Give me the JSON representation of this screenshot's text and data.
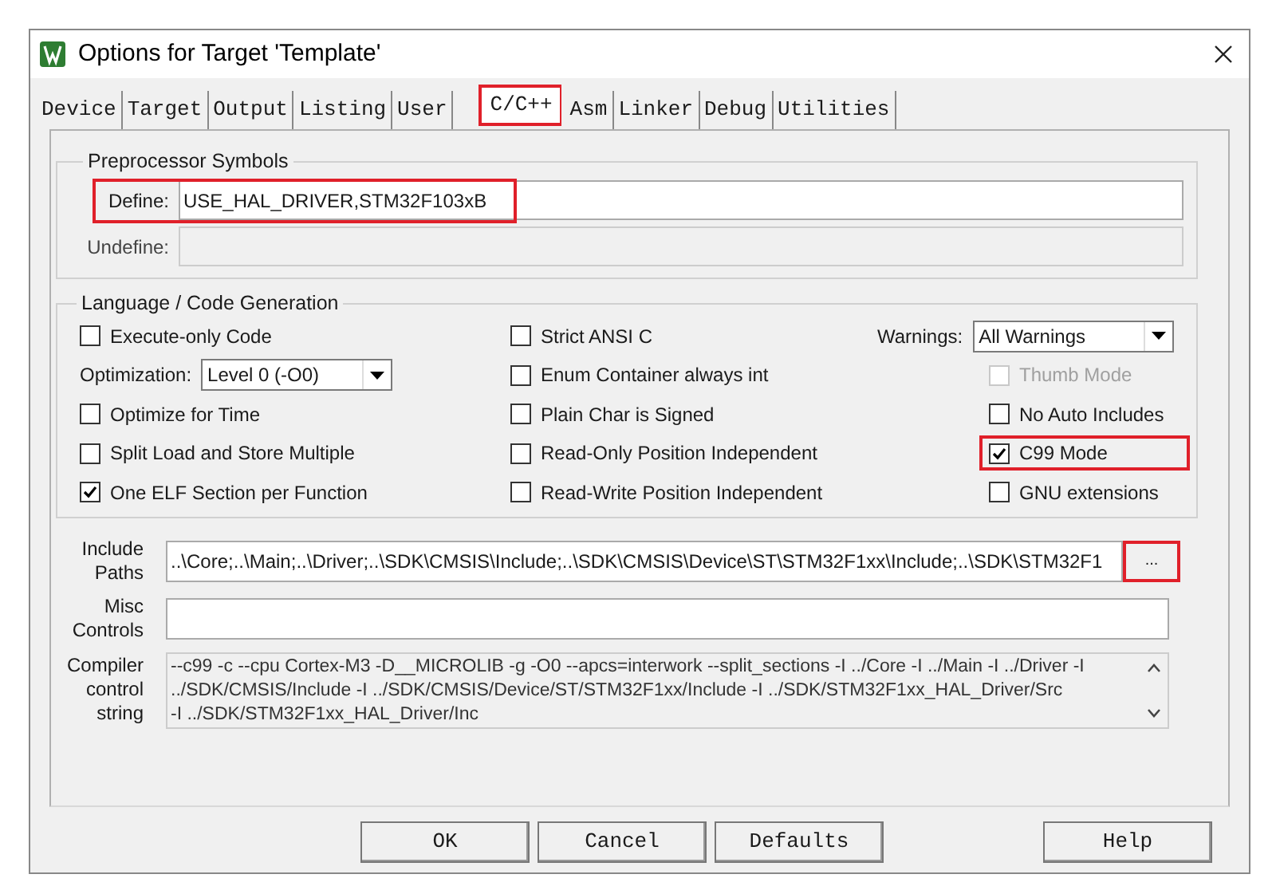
{
  "window": {
    "title": "Options for Target 'Template'"
  },
  "tabs": [
    {
      "label": "Device",
      "selected": false,
      "highlighted": false
    },
    {
      "label": "Target",
      "selected": false,
      "highlighted": false
    },
    {
      "label": "Output",
      "selected": false,
      "highlighted": false
    },
    {
      "label": "Listing",
      "selected": false,
      "highlighted": false
    },
    {
      "label": "User",
      "selected": false,
      "highlighted": false
    },
    {
      "label": "C/C++",
      "selected": true,
      "highlighted": true
    },
    {
      "label": "Asm",
      "selected": false,
      "highlighted": false
    },
    {
      "label": "Linker",
      "selected": false,
      "highlighted": false
    },
    {
      "label": "Debug",
      "selected": false,
      "highlighted": false
    },
    {
      "label": "Utilities",
      "selected": false,
      "highlighted": false
    }
  ],
  "preprocessor": {
    "title": "Preprocessor Symbols",
    "define": {
      "label": "Define:",
      "value": "USE_HAL_DRIVER,STM32F103xB",
      "highlighted": true
    },
    "undefine": {
      "label": "Undefine:",
      "disabled": true
    }
  },
  "language": {
    "title": "Language / Code Generation",
    "columns": [
      [
        {
          "kind": "checkbox",
          "label": "Execute-only Code",
          "checked": false,
          "disabled": false,
          "highlighted": false
        },
        {
          "kind": "select",
          "label": "Optimization:",
          "value": "Level 0 (-O0)"
        },
        {
          "kind": "checkbox",
          "label": "Optimize for Time",
          "checked": false,
          "disabled": false,
          "highlighted": false
        },
        {
          "kind": "checkbox",
          "label": "Split Load and Store Multiple",
          "checked": false,
          "disabled": false,
          "highlighted": false
        },
        {
          "kind": "checkbox",
          "label": "One ELF Section per Function",
          "checked": true,
          "disabled": false,
          "highlighted": false
        }
      ],
      [
        {
          "kind": "checkbox",
          "label": "Strict ANSI C",
          "checked": false,
          "disabled": false,
          "highlighted": false
        },
        {
          "kind": "checkbox",
          "label": "Enum Container always int",
          "checked": false,
          "disabled": false,
          "highlighted": false
        },
        {
          "kind": "checkbox",
          "label": "Plain Char is Signed",
          "checked": false,
          "disabled": false,
          "highlighted": false
        },
        {
          "kind": "checkbox",
          "label": "Read-Only Position Independent",
          "checked": false,
          "disabled": false,
          "highlighted": false
        },
        {
          "kind": "checkbox",
          "label": "Read-Write Position Independent",
          "checked": false,
          "disabled": false,
          "highlighted": false
        }
      ],
      [
        {
          "kind": "select",
          "label": "Warnings:",
          "value": "All Warnings"
        },
        {
          "kind": "checkbox",
          "label": "Thumb Mode",
          "checked": false,
          "disabled": true,
          "highlighted": false
        },
        {
          "kind": "checkbox",
          "label": "No Auto Includes",
          "checked": false,
          "disabled": false,
          "highlighted": false
        },
        {
          "kind": "checkbox",
          "label": "C99 Mode",
          "checked": true,
          "disabled": false,
          "highlighted": true
        },
        {
          "kind": "checkbox",
          "label": "GNU extensions",
          "checked": false,
          "disabled": false,
          "highlighted": false
        }
      ]
    ]
  },
  "include_paths": {
    "label": "Include Paths",
    "value": "..\\Core;..\\Main;..\\Driver;..\\SDK\\CMSIS\\Include;..\\SDK\\CMSIS\\Device\\ST\\STM32F1xx\\Include;..\\SDK\\STM32F1",
    "browse": "...",
    "browse_highlighted": true
  },
  "misc_controls": {
    "label": "Misc Controls"
  },
  "compiler_control_string": {
    "label": "Compiler control string",
    "lines": [
      "--c99 -c --cpu Cortex-M3 -D__MICROLIB -g -O0 --apcs=interwork --split_sections -I ../Core -I ../Main -I ../Driver -I",
      "../SDK/CMSIS/Include -I ../SDK/CMSIS/Device/ST/STM32F1xx/Include -I ../SDK/STM32F1xx_HAL_Driver/Src",
      "-I ../SDK/STM32F1xx_HAL_Driver/Inc"
    ]
  },
  "buttons": [
    "OK",
    "Cancel",
    "Defaults",
    "Help"
  ]
}
